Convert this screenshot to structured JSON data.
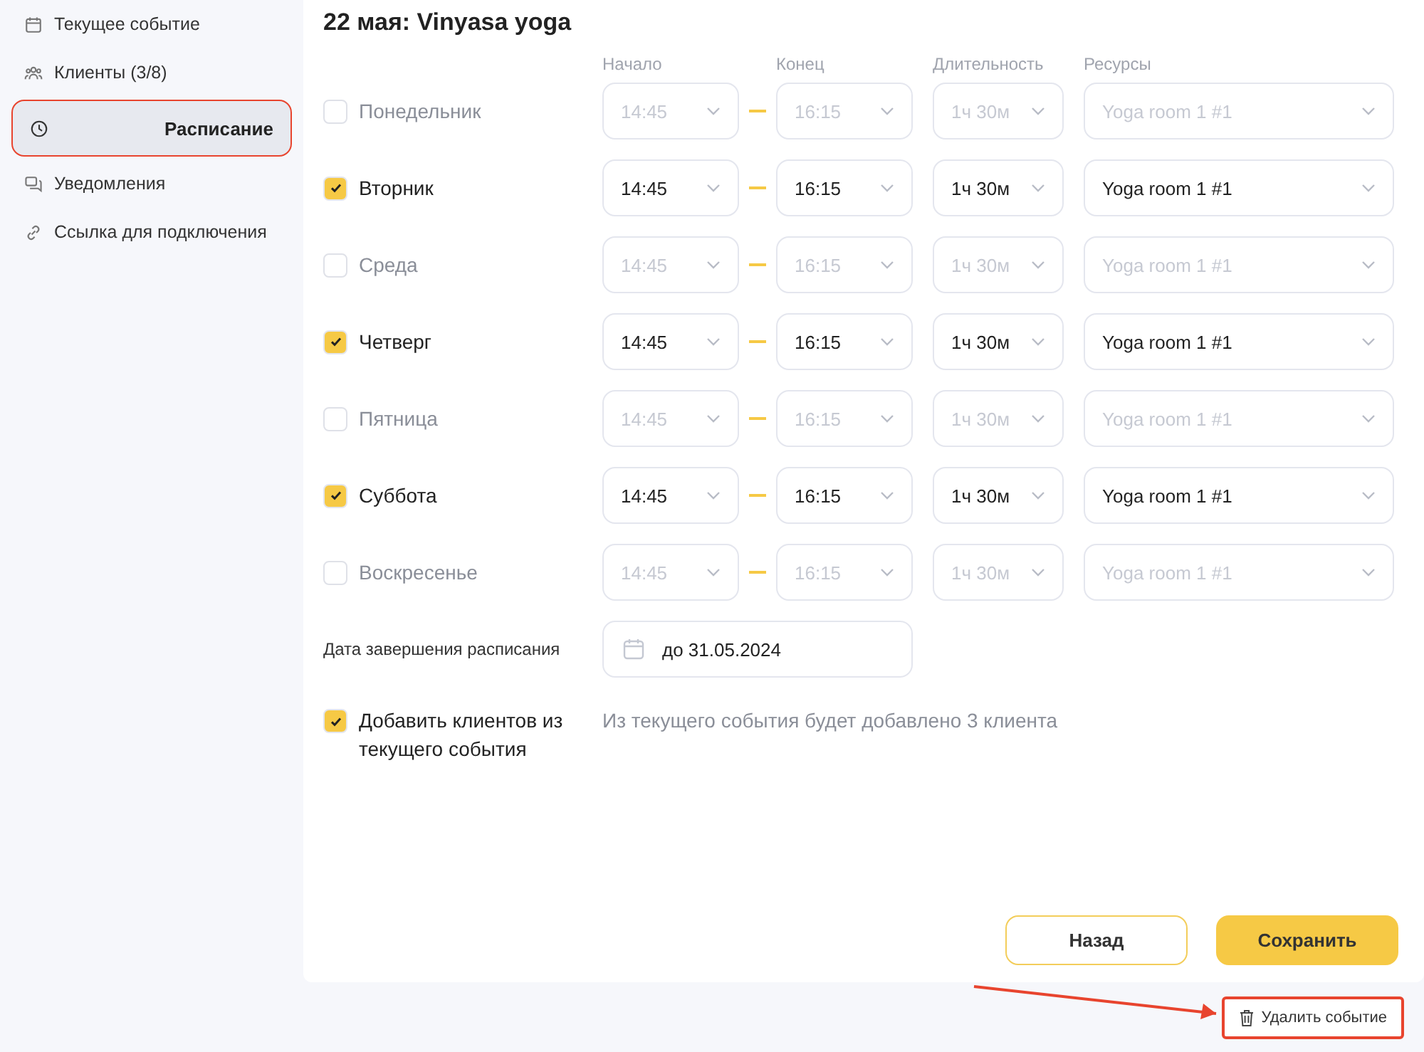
{
  "sidebar": {
    "items": [
      {
        "label": "Текущее событие",
        "selected": false,
        "annotated": false
      },
      {
        "label": "Клиенты (3/8)",
        "selected": false,
        "annotated": false
      },
      {
        "label": "Расписание",
        "selected": true,
        "annotated": true
      },
      {
        "label": "Уведомления",
        "selected": false,
        "annotated": false
      },
      {
        "label": "Ссылка для подключения",
        "selected": false,
        "annotated": false
      }
    ]
  },
  "title": "22 мая: Vinyasa yoga",
  "columns": [
    "Начало",
    "Конец",
    "Длительность",
    "Ресурсы"
  ],
  "days": [
    {
      "day": "Понедельник",
      "checked": false,
      "start": "14:45",
      "end": "16:15",
      "duration": "1ч 30м",
      "resource": "Yoga room 1 #1"
    },
    {
      "day": "Вторник",
      "checked": true,
      "start": "14:45",
      "end": "16:15",
      "duration": "1ч 30м",
      "resource": "Yoga room 1 #1"
    },
    {
      "day": "Среда",
      "checked": false,
      "start": "14:45",
      "end": "16:15",
      "duration": "1ч 30м",
      "resource": "Yoga room 1 #1"
    },
    {
      "day": "Четверг",
      "checked": true,
      "start": "14:45",
      "end": "16:15",
      "duration": "1ч 30м",
      "resource": "Yoga room 1 #1"
    },
    {
      "day": "Пятница",
      "checked": false,
      "start": "14:45",
      "end": "16:15",
      "duration": "1ч 30м",
      "resource": "Yoga room 1 #1"
    },
    {
      "day": "Суббота",
      "checked": true,
      "start": "14:45",
      "end": "16:15",
      "duration": "1ч 30м",
      "resource": "Yoga room 1 #1"
    },
    {
      "day": "Воскресенье",
      "checked": false,
      "start": "14:45",
      "end": "16:15",
      "duration": "1ч 30м",
      "resource": "Yoga room 1 #1"
    }
  ],
  "end_date": {
    "label": "Дата завершения расписания",
    "value": "до 31.05.2024"
  },
  "add_clients": {
    "label": "Добавить клиентов из текущего события",
    "checked": true,
    "note": "Из текущего события будет добавлено 3 клиента"
  },
  "buttons": [
    {
      "label": "Назад",
      "kind": "secondary"
    },
    {
      "label": "Сохранить",
      "kind": "primary"
    }
  ],
  "delete_button": {
    "label": "Удалить событие",
    "annotated": true
  }
}
